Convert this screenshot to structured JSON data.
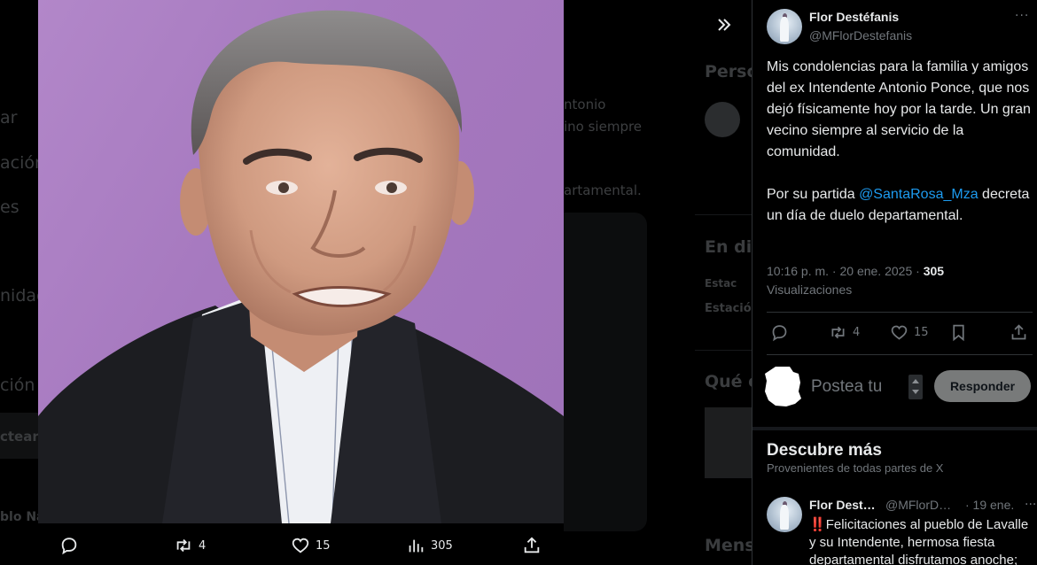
{
  "background": {
    "left_fragments": [
      "ar",
      "ación",
      "es",
      "nidad",
      "ción",
      "ctear",
      "blo Na"
    ],
    "tweet_fragments": [
      "ntonio",
      "ino siempre",
      "artamental."
    ],
    "right_headings": [
      "Perso",
      "En di",
      "Qué e",
      "Mens"
    ],
    "right_small": [
      "Estac",
      "Estación"
    ]
  },
  "viewer": {
    "expand_icon": "double-chevron-right-icon",
    "actions": {
      "replies": "",
      "retweets": "4",
      "likes": "15",
      "views": "305"
    }
  },
  "tweet": {
    "author_name": "Flor Destéfanis",
    "author_handle": "@MFlorDestefanis",
    "more": "···",
    "text_p1": "Mis condolencias para la familia y amigos del ex Intendente Antonio Ponce, que nos dejó físicamente hoy por la tarde. Un gran vecino siempre al servicio de la comunidad.",
    "text_p2_before": "Por su partida ",
    "text_p2_mention": "@SantaRosa_Mza",
    "text_p2_after": " decreta un día de duelo departamental.",
    "timestamp": "10:16 p. m. · 20 ene. 2025",
    "separator": " · ",
    "views_count": "305",
    "views_label": "Visualizaciones",
    "stats": {
      "retweets": "4",
      "likes": "15"
    }
  },
  "reply": {
    "placeholder": "Postea tu",
    "button_label": "Responder"
  },
  "discover": {
    "title": "Descubre más",
    "subtitle": "Provenientes de todas partes de X",
    "item": {
      "name": "Flor Dest…",
      "handle": "@MFlorD…",
      "date": "· 19 ene.",
      "more": "···",
      "bang": "‼️",
      "text": "Felicitaciones al pueblo de Lavalle y su Intendente, hermosa fiesta departamental disfrutamos anoche;"
    }
  },
  "colors": {
    "accent": "#1d9bf0",
    "photo_bg": "#a679bf",
    "reply_button": "#787a7a",
    "text_secondary": "#71767b"
  }
}
